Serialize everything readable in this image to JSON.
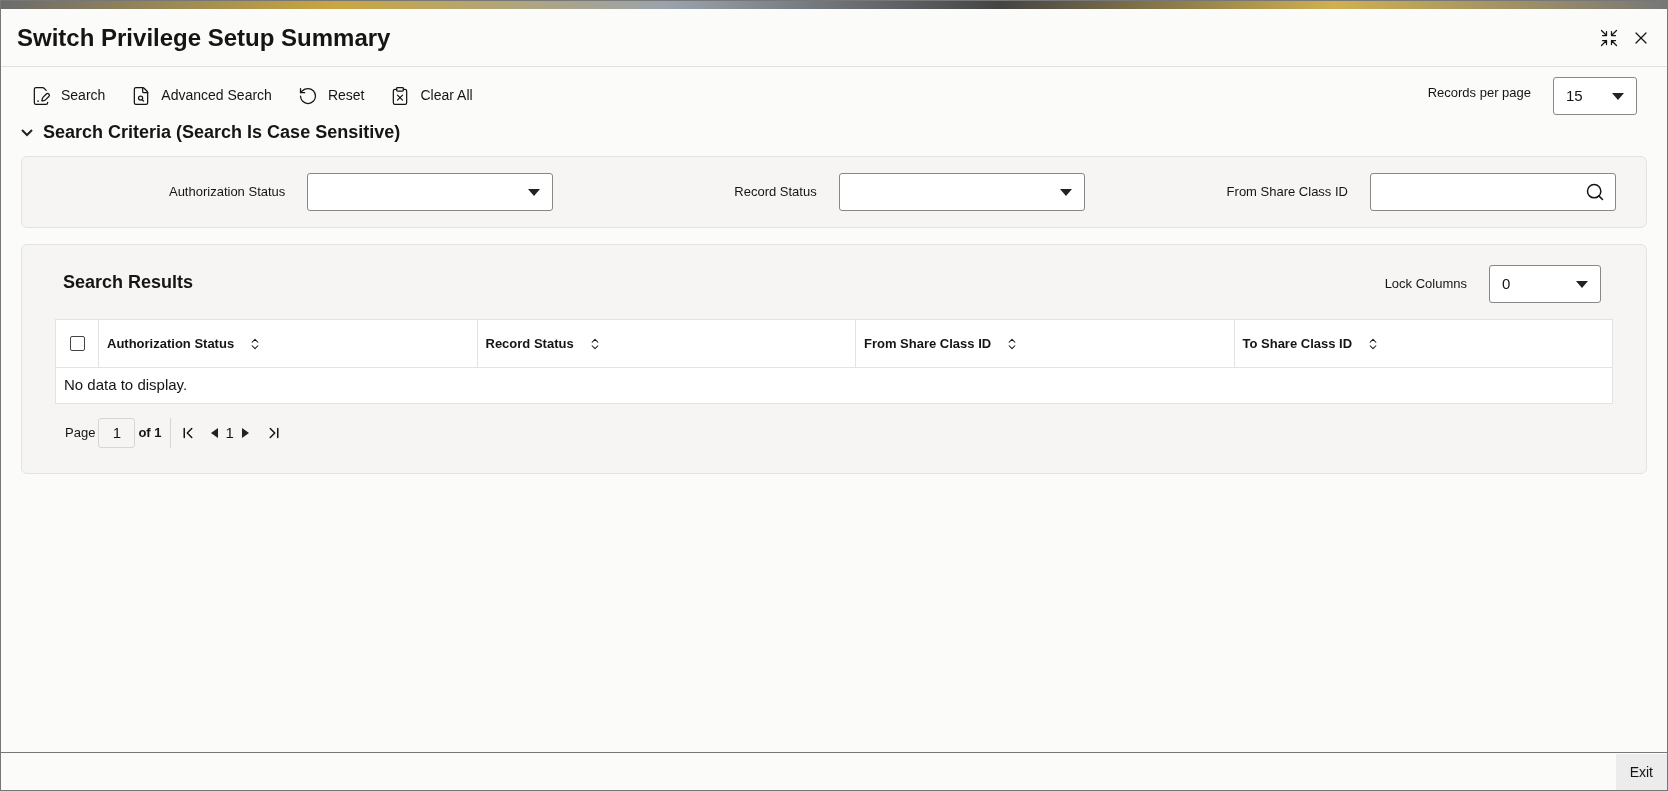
{
  "window": {
    "title": "Switch Privilege Setup Summary"
  },
  "toolbar": [
    {
      "kind": "search",
      "label": "Search"
    },
    {
      "kind": "advanced",
      "label": "Advanced Search"
    },
    {
      "kind": "reset",
      "label": "Reset"
    },
    {
      "kind": "clear",
      "label": "Clear All"
    }
  ],
  "records_per_page": {
    "label": "Records per page",
    "value": "15"
  },
  "criteria": {
    "title": "Search Criteria (Search Is Case Sensitive)",
    "expanded": true,
    "fields": [
      {
        "kind": "select",
        "label": "Authorization Status"
      },
      {
        "kind": "select",
        "label": "Record Status"
      },
      {
        "kind": "lookup",
        "label": "From Share Class ID"
      }
    ]
  },
  "results": {
    "title": "Search Results",
    "lock_columns": {
      "label": "Lock Columns",
      "value": "0"
    },
    "select_all": {
      "checked": false
    },
    "columns": [
      "Authorization Status",
      "Record Status",
      "From Share Class ID",
      "To Share Class ID"
    ],
    "empty_text": "No data to display.",
    "pagination": {
      "page_label": "Page",
      "page": "1",
      "of_label": "of 1",
      "current": "1"
    }
  },
  "footer": {
    "exit": "Exit"
  }
}
